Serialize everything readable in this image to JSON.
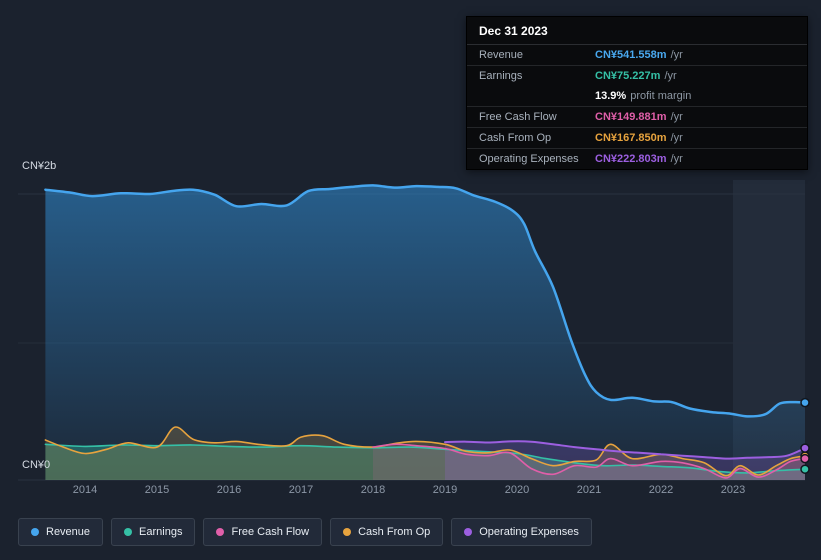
{
  "tooltip": {
    "date": "Dec 31 2023",
    "rows": [
      {
        "label": "Revenue",
        "value": "CN¥541.558m",
        "unit": "/yr",
        "color": "#49a8ef"
      },
      {
        "label": "Earnings",
        "value": "CN¥75.227m",
        "unit": "/yr",
        "color": "#35c0a6"
      },
      {
        "label": "",
        "value": "13.9%",
        "unit": "profit margin",
        "color": "#ffffff"
      },
      {
        "label": "Free Cash Flow",
        "value": "CN¥149.881m",
        "unit": "/yr",
        "color": "#e05fa9"
      },
      {
        "label": "Cash From Op",
        "value": "CN¥167.850m",
        "unit": "/yr",
        "color": "#e7a33e"
      },
      {
        "label": "Operating Expenses",
        "value": "CN¥222.803m",
        "unit": "/yr",
        "color": "#9c5fe0"
      }
    ]
  },
  "legend": [
    {
      "label": "Revenue",
      "color": "#45a5ee"
    },
    {
      "label": "Earnings",
      "color": "#35c0a6"
    },
    {
      "label": "Free Cash Flow",
      "color": "#e05fa9"
    },
    {
      "label": "Cash From Op",
      "color": "#e7a33e"
    },
    {
      "label": "Operating Expenses",
      "color": "#9c5fe0"
    }
  ],
  "chart_data": {
    "type": "area",
    "title": "Financial history: revenue, earnings and cash flow (CN¥ millions)",
    "x_axis": {
      "years": [
        2014,
        2015,
        2016,
        2017,
        2018,
        2019,
        2020,
        2021,
        2022,
        2023
      ],
      "range": [
        2013.45,
        2024
      ]
    },
    "y_axis": {
      "top_label": "CN¥2b",
      "bottom_label": "CN¥0",
      "unit": "CN¥ millions",
      "gridline_values_m": [
        2000,
        1000,
        0
      ]
    },
    "highlight_band": {
      "from": 2023,
      "to": 2024
    },
    "grid": true,
    "legend_position": "bottom-left",
    "series": [
      {
        "name": "Revenue",
        "color": "#45a5ee",
        "width": 2.5,
        "area_opacity": 0.45,
        "gradient": true,
        "x": [
          2013.45,
          2013.8,
          2014.1,
          2014.5,
          2014.9,
          2015.2,
          2015.5,
          2015.8,
          2016.1,
          2016.45,
          2016.8,
          2017.1,
          2017.4,
          2017.7,
          2018.0,
          2018.3,
          2018.6,
          2018.9,
          2019.15,
          2019.4,
          2019.7,
          2019.95,
          2020.1,
          2020.25,
          2020.5,
          2020.75,
          2020.95,
          2021.1,
          2021.3,
          2021.6,
          2021.9,
          2022.15,
          2022.4,
          2022.7,
          2022.95,
          2023.2,
          2023.45,
          2023.65,
          2023.85,
          2024.0
        ],
        "values_m": [
          2030,
          2010,
          1985,
          2005,
          2000,
          2020,
          2030,
          1995,
          1915,
          1930,
          1920,
          2020,
          2035,
          2050,
          2060,
          2045,
          2055,
          2050,
          2040,
          1990,
          1945,
          1880,
          1790,
          1600,
          1350,
          980,
          730,
          615,
          560,
          575,
          550,
          545,
          500,
          475,
          465,
          445,
          460,
          535,
          545,
          541.558
        ]
      },
      {
        "name": "Earnings",
        "color": "#35c0a6",
        "width": 1.6,
        "area_opacity": 0.35,
        "gradient": false,
        "x": [
          2013.45,
          2014,
          2014.5,
          2015,
          2015.5,
          2016,
          2016.5,
          2017,
          2017.5,
          2018,
          2018.5,
          2019,
          2019.5,
          2020,
          2020.4,
          2020.8,
          2021.2,
          2021.6,
          2022,
          2022.4,
          2022.8,
          2023.2,
          2023.6,
          2024
        ],
        "values_m": [
          250,
          235,
          245,
          240,
          245,
          235,
          230,
          240,
          230,
          225,
          230,
          215,
          200,
          185,
          150,
          120,
          100,
          105,
          95,
          85,
          60,
          50,
          65,
          75.227
        ]
      },
      {
        "name": "Cash From Op",
        "color": "#e7a33e",
        "width": 1.6,
        "area_opacity": 0.2,
        "gradient": false,
        "x": [
          2013.45,
          2013.7,
          2014,
          2014.3,
          2014.6,
          2015,
          2015.25,
          2015.5,
          2015.8,
          2016.1,
          2016.4,
          2016.8,
          2017,
          2017.3,
          2017.6,
          2018,
          2018.3,
          2018.6,
          2019,
          2019.3,
          2019.6,
          2019.9,
          2020.2,
          2020.5,
          2020.8,
          2021.1,
          2021.3,
          2021.6,
          2022,
          2022.3,
          2022.6,
          2022.9,
          2023.1,
          2023.35,
          2023.6,
          2023.8,
          2024
        ],
        "values_m": [
          280,
          230,
          185,
          215,
          260,
          230,
          370,
          285,
          260,
          270,
          250,
          240,
          300,
          310,
          250,
          230,
          255,
          270,
          250,
          200,
          190,
          210,
          150,
          100,
          130,
          140,
          250,
          150,
          180,
          150,
          120,
          30,
          100,
          35,
          100,
          150,
          167.85
        ]
      },
      {
        "name": "Free Cash Flow",
        "color": "#e05fa9",
        "width": 1.6,
        "area_opacity": 0.15,
        "gradient": false,
        "x": [
          2018,
          2018.3,
          2018.6,
          2019,
          2019.3,
          2019.6,
          2019.9,
          2020.2,
          2020.5,
          2020.8,
          2021.1,
          2021.3,
          2021.6,
          2022,
          2022.3,
          2022.6,
          2022.9,
          2023.1,
          2023.35,
          2023.6,
          2023.8,
          2024
        ],
        "values_m": [
          230,
          250,
          240,
          220,
          180,
          170,
          190,
          80,
          40,
          100,
          90,
          150,
          100,
          130,
          120,
          80,
          15,
          80,
          20,
          70,
          130,
          149.881
        ]
      },
      {
        "name": "Operating Expenses",
        "color": "#9c5fe0",
        "width": 2,
        "area_opacity": 0.22,
        "gradient": false,
        "x": [
          2019,
          2019.3,
          2019.6,
          2019.9,
          2020.2,
          2020.5,
          2020.8,
          2021.1,
          2021.4,
          2021.7,
          2022,
          2022.3,
          2022.6,
          2022.9,
          2023.2,
          2023.5,
          2023.75,
          2024
        ],
        "values_m": [
          265,
          268,
          262,
          270,
          268,
          250,
          230,
          215,
          200,
          190,
          180,
          170,
          160,
          150,
          155,
          160,
          170,
          222.803
        ]
      }
    ]
  }
}
